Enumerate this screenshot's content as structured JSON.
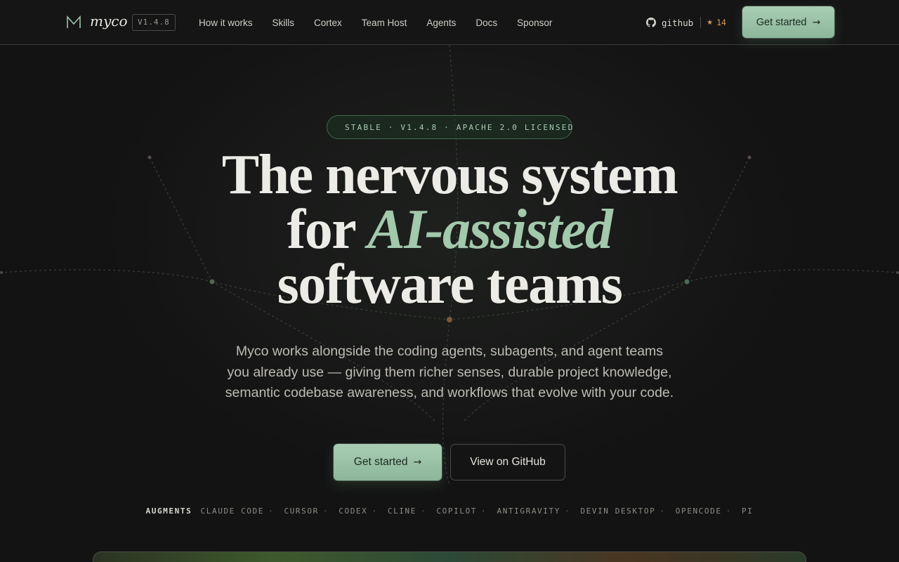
{
  "nav": {
    "logo_text": "myco",
    "version": "V1.4.8",
    "links": [
      "How it works",
      "Skills",
      "Cortex",
      "Team Host",
      "Agents",
      "Docs",
      "Sponsor"
    ],
    "github_label": "github",
    "star_count": "14",
    "cta_label": "Get started"
  },
  "hero": {
    "badge": "STABLE · V1.4.8 · APACHE 2.0 LICENSED",
    "headline_line1": "The nervous system",
    "headline_for": "for",
    "headline_accent": "AI-assisted",
    "headline_line3": "software teams",
    "subtext": "Myco works alongside the coding agents, subagents, and agent teams you already use — giving them richer senses, durable project knowledge, semantic codebase awareness, and workflows that evolve with your code.",
    "primary_cta": "Get started",
    "secondary_cta": "View on GitHub"
  },
  "augments": {
    "heading": "AUGMENTS",
    "items": [
      "CLAUDE CODE",
      "CURSOR",
      "CODEX",
      "CLINE",
      "COPILOT",
      "ANTIGRAVITY",
      "DEVIN DESKTOP",
      "OPENCODE",
      "PI"
    ]
  },
  "colors": {
    "accent": "#a3c9ad",
    "button": "#9cc3a8",
    "star": "#d39a55",
    "background": "#141414"
  }
}
